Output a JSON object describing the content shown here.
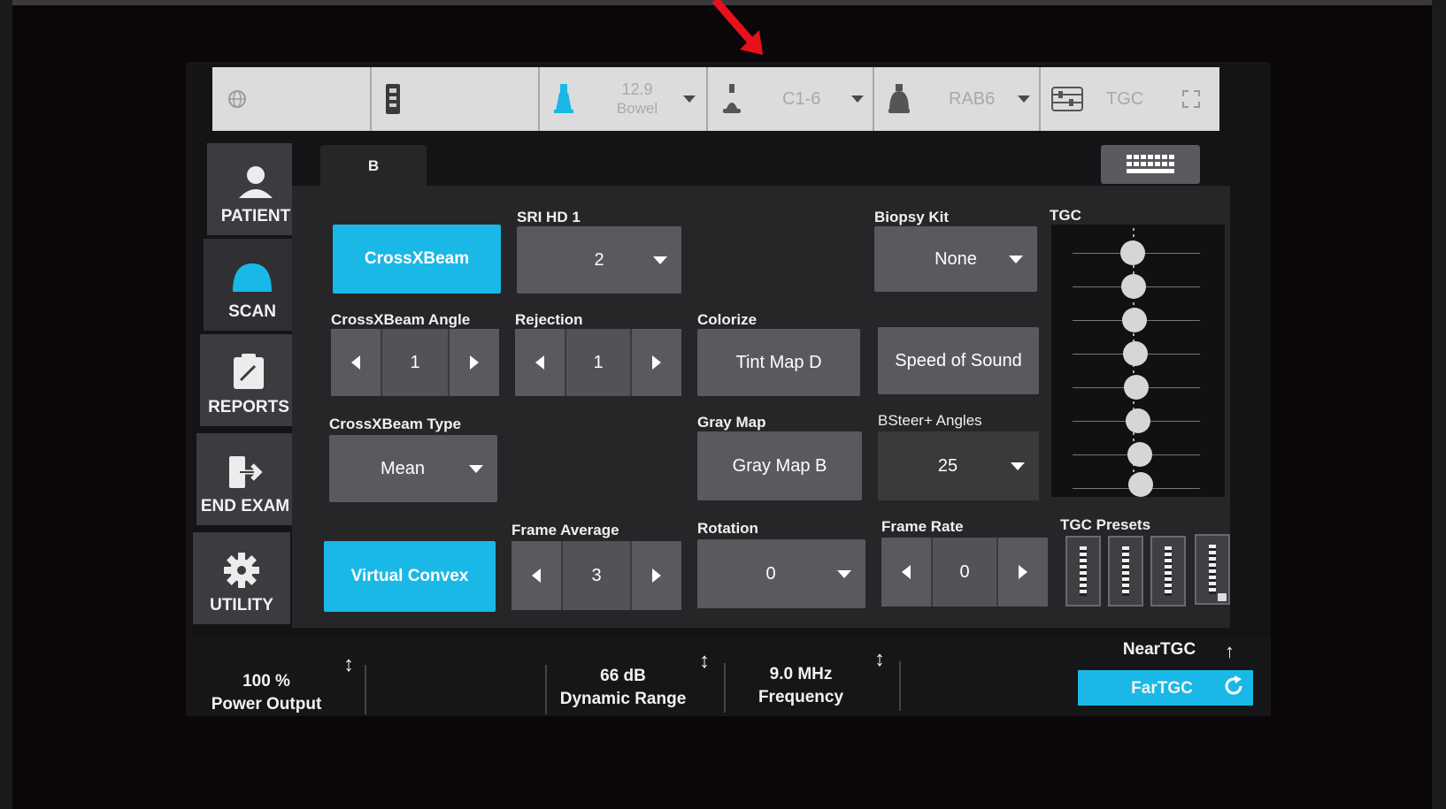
{
  "topbar": {
    "probe1_line1": "12.9",
    "probe1_line2": "Bowel",
    "probe2": "C1-6",
    "probe3": "RAB6",
    "tgc": "TGC"
  },
  "nav": {
    "patient": "PATIENT",
    "scan": "SCAN",
    "reports": "REPORTS",
    "end_exam": "END EXAM",
    "utility": "UTILITY"
  },
  "tabs": {
    "b": "B"
  },
  "controls": {
    "crossxbeam": "CrossXBeam",
    "sri_label": "SRI HD 1",
    "sri_value": "2",
    "biopsy_label": "Biopsy Kit",
    "biopsy_value": "None",
    "crossxbeam_angle_label": "CrossXBeam Angle",
    "crossxbeam_angle_value": "1",
    "rejection_label": "Rejection",
    "rejection_value": "1",
    "colorize_label": "Colorize",
    "colorize_value": "Tint Map D",
    "speed_of_sound": "Speed of Sound",
    "crossxbeam_type_label": "CrossXBeam Type",
    "crossxbeam_type_value": "Mean",
    "gray_map_label": "Gray Map",
    "gray_map_value": "Gray Map B",
    "bsteer_label": "BSteer+ Angles",
    "bsteer_value": "25",
    "virtual_convex": "Virtual Convex",
    "frame_average_label": "Frame Average",
    "frame_average_value": "3",
    "rotation_label": "Rotation",
    "rotation_value": "0",
    "frame_rate_label": "Frame Rate",
    "frame_rate_value": "0",
    "tgc_label": "TGC",
    "tgc_presets_label": "TGC Presets"
  },
  "bottom": {
    "power_value": "100 %",
    "power_label": "Power Output",
    "dynamic_value": "66 dB",
    "dynamic_label": "Dynamic Range",
    "freq_value": "9.0 MHz",
    "freq_label": "Frequency",
    "near_tgc": "NearTGC",
    "far_tgc": "FarTGC"
  },
  "colors": {
    "accent": "#1ab8e6",
    "panel": "#262629",
    "button": "#5a5a5e"
  }
}
